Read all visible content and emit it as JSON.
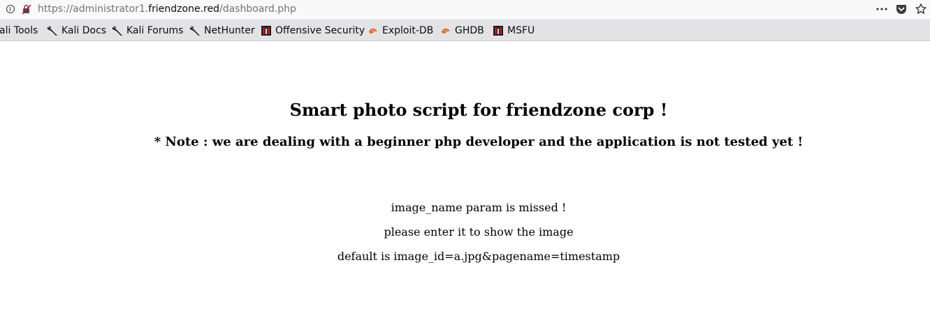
{
  "urlbar": {
    "url_prefix": "https://administrator1.",
    "url_host": "friendzone.red",
    "url_path": "/dashboard.php"
  },
  "bookmarks": [
    {
      "label": "ali Tools",
      "icon": "kali-icon"
    },
    {
      "label": "Kali Docs",
      "icon": "kali-icon"
    },
    {
      "label": "Kali Forums",
      "icon": "kali-icon"
    },
    {
      "label": "NetHunter",
      "icon": "kali-icon"
    },
    {
      "label": "Offensive Security",
      "icon": "offsec-icon"
    },
    {
      "label": "Exploit-DB",
      "icon": "exploitdb-icon"
    },
    {
      "label": "GHDB",
      "icon": "exploitdb-icon"
    },
    {
      "label": "MSFU",
      "icon": "offsec-icon"
    }
  ],
  "page": {
    "title": "Smart photo script for friendzone corp !",
    "note": "* Note : we are dealing with a beginner php developer and the application is not tested yet !",
    "messages": [
      "image_name param is missed !",
      "please enter it to show the image",
      "default is image_id=a.jpg&pagename=timestamp"
    ]
  },
  "colors": {
    "bookmarks_bar": "#e3e3e5",
    "urlbar": "#f9f9fa",
    "exploitdb_orange": "#e8622c"
  }
}
